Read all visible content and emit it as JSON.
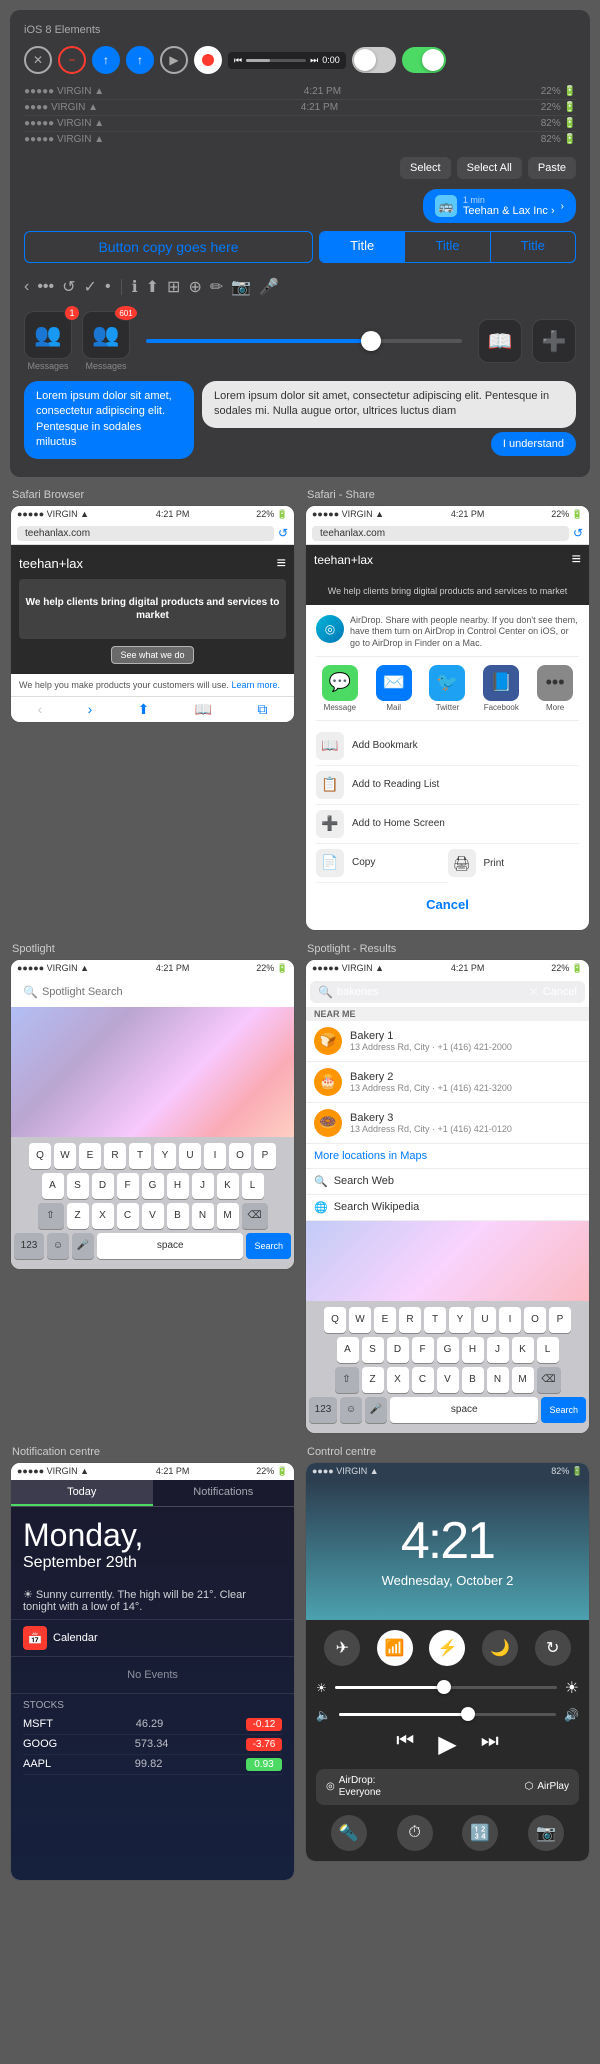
{
  "app": {
    "title": "iOS 8 Elements"
  },
  "controls": {
    "close_icon": "✕",
    "minus_icon": "−",
    "up_icon": "↑",
    "up2_icon": "↑",
    "play_icon": "▶",
    "record_label": "record",
    "time": "0:00",
    "toggle_off_label": "toggle-off",
    "toggle_on_label": "toggle-on"
  },
  "status_bars": [
    {
      "signal": "●●●●● VIRGIN",
      "wifi": "▲",
      "time": "4:21 PM",
      "battery_pct": "22%",
      "battery_width": "22"
    },
    {
      "signal": "●●●● VIRGIN",
      "wifi": "▲",
      "time": "4:21 PM",
      "battery_pct": "22%",
      "battery_width": "22"
    },
    {
      "signal": "●●●●● VIRGIN",
      "wifi": "▲",
      "time": "",
      "battery_pct": "82%",
      "battery_width": "82"
    },
    {
      "signal": "●●●●● VIRGIN",
      "wifi": "▲",
      "time": "",
      "battery_pct": "82%",
      "battery_width": "82"
    }
  ],
  "popup_buttons": {
    "select": "Select",
    "select_all": "Select All",
    "paste": "Paste"
  },
  "notification_bubble": {
    "icon": "🚌",
    "time": "1 min",
    "text": "Teehan & Lax Inc ›"
  },
  "button_copy": "Button copy goes here",
  "segmented": {
    "items": [
      "Title",
      "Title",
      "Title"
    ],
    "active_index": 0
  },
  "toolbar": {
    "icons": [
      "‹",
      "•••",
      "↺",
      "✓",
      "•",
      "ℹ",
      "⬆",
      "⊞",
      "⊕",
      "✏",
      "📷",
      "🎤"
    ]
  },
  "messages": [
    {
      "label": "Messages",
      "badge": "1",
      "icon": "👥"
    },
    {
      "label": "Messages",
      "badge": "601",
      "icon": "👥"
    }
  ],
  "chat": {
    "blue_bubble": "Lorem ipsum dolor sit amet, consectetur adipiscing elit. Pentesque in sodales miluctus",
    "white_bubble": "Lorem ipsum dolor sit amet, consectetur adipiscing elit. Pentesque in sodales mi. Nulla augue ortor, ultrices luctus diam",
    "understand_btn": "I understand"
  },
  "safari": {
    "label": "Safari Browser",
    "share_label": "Safari - Share",
    "url": "teehanlax.com",
    "logo": "teehan+lax",
    "tagline": "We help clients bring\ndigital products and\nservices to market",
    "cta": "See what we do",
    "bottom_text": "We help you make products your customers will use.",
    "learn_more": "Learn more.",
    "airdrop_text": "AirDrop. Share with people nearby. If you don't see them, have them turn on AirDrop in Control Center on iOS, or go to AirDrop in Finder on a Mac.",
    "share_apps": [
      {
        "icon": "💬",
        "color": "#4cd964",
        "label": "Message"
      },
      {
        "icon": "✉️",
        "color": "#007aff",
        "label": "Mail"
      },
      {
        "icon": "🐦",
        "color": "#1da1f2",
        "label": "Twitter"
      },
      {
        "icon": "📘",
        "color": "#3b5998",
        "label": "Facebook"
      },
      {
        "icon": "•••",
        "color": "#888",
        "label": "More"
      }
    ],
    "share_actions": [
      {
        "icon": "📖",
        "label": "Add Bookmark"
      },
      {
        "icon": "📋",
        "label": "Add to Reading List"
      },
      {
        "icon": "📱",
        "label": "Add to Home Screen"
      },
      {
        "icon": "📋",
        "label": "Copy"
      },
      {
        "icon": "🖨",
        "label": "Print"
      }
    ],
    "cancel": "Cancel"
  },
  "spotlight": {
    "label": "Spotlight",
    "results_label": "Spotlight - Results",
    "placeholder": "Spotlight Search",
    "cancel": "Cancel",
    "query": "bakeries",
    "maps_link": "More locations in Maps",
    "search_web": "Search Web",
    "search_wiki": "Search Wikipedia",
    "results_section": "NEAR ME",
    "results": [
      {
        "icon": "🍞",
        "color": "#ff9500",
        "name": "Bakery 1",
        "detail": "13 Address Rd, City\n+1 (416) 421-2000"
      },
      {
        "icon": "🎂",
        "color": "#ff9500",
        "name": "Bakery 2",
        "detail": "13 Address Rd, City\n+1 (416) 421-3200"
      },
      {
        "icon": "🍩",
        "color": "#ff9500",
        "name": "Bakery 3",
        "detail": "13 Address Rd, City\n+1 (416) 421-0120"
      }
    ],
    "keyboard_row1": [
      "Q",
      "W",
      "E",
      "R",
      "T",
      "Y",
      "U",
      "I",
      "O",
      "P"
    ],
    "keyboard_row2": [
      "A",
      "S",
      "D",
      "F",
      "G",
      "H",
      "J",
      "K",
      "L"
    ],
    "keyboard_row3": [
      "Z",
      "X",
      "C",
      "V",
      "B",
      "N",
      "M"
    ],
    "key_123": "123",
    "key_emoji": "☺",
    "key_mic": "🎤",
    "key_space": "space",
    "key_search": "Search"
  },
  "notification_centre": {
    "label": "Notification centre",
    "tab_today": "Today",
    "tab_notifications": "Notifications",
    "day": "Monday,",
    "date": "September 29th",
    "weather": "☀ Sunny currently. The high will be 21°. Clear tonight with a low of 14°.",
    "calendar_label": "Calendar",
    "no_events": "No Events",
    "stocks_label": "Stocks",
    "stocks": [
      {
        "name": "MSFT",
        "price": "46.29",
        "change": "-0.12",
        "type": "red"
      },
      {
        "name": "GOOG",
        "price": "573.34",
        "change": "-3.76",
        "type": "red"
      },
      {
        "name": "AAPL",
        "price": "99.82",
        "change": "0.93",
        "type": "green"
      }
    ]
  },
  "control_centre": {
    "label": "Control centre",
    "time": "4:21",
    "date": "Wednesday, October 2",
    "toggles": [
      {
        "icon": "✈",
        "label": "airplane",
        "active": false
      },
      {
        "icon": "📶",
        "label": "wifi",
        "active": true
      },
      {
        "icon": "⚡",
        "label": "bluetooth",
        "active": true
      },
      {
        "icon": "🌙",
        "label": "dnd",
        "active": false
      },
      {
        "icon": "↻",
        "label": "rotation",
        "active": false
      }
    ],
    "brightness_icon_low": "☀",
    "brightness_icon_high": "☀",
    "brightness_pct": 50,
    "volume_icon_low": "🔈",
    "volume_icon_high": "🔊",
    "volume_pct": 60,
    "prev_icon": "⏮",
    "play_icon": "▶",
    "next_icon": "⏭",
    "airdrop_label": "AirDrop:\nEveryone",
    "airplay_label": "AirPlay",
    "bottom_icons": [
      "🔦",
      "⏱",
      "🔢",
      "📷"
    ]
  }
}
